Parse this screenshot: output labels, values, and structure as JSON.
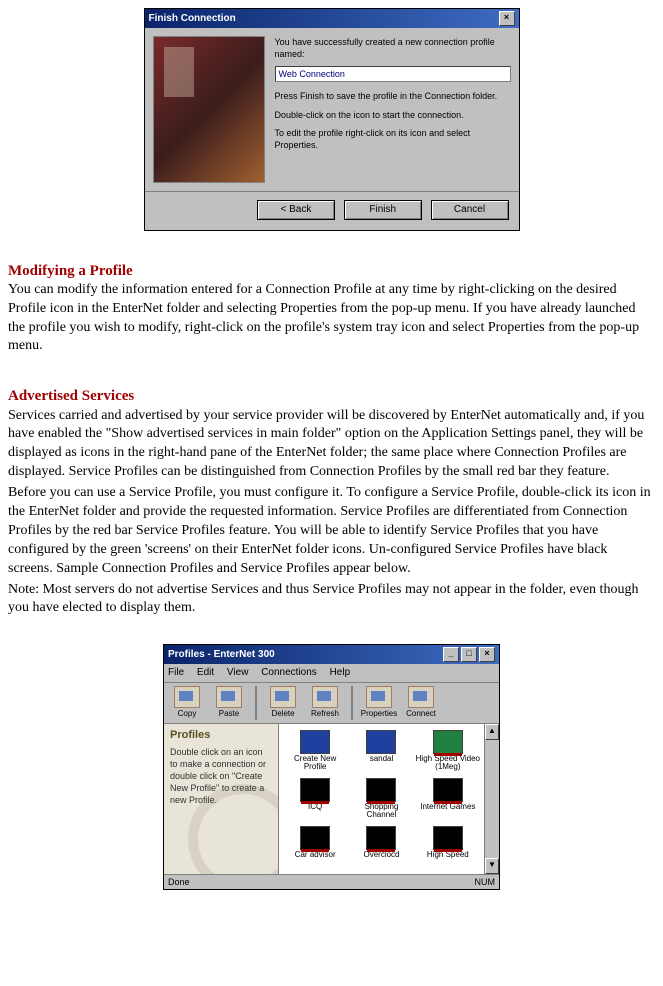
{
  "dialog1": {
    "title": "Finish Connection",
    "success_line": "You have successfully created a new connection profile named:",
    "profile_name": "Web Connection",
    "inst_finish": "Press Finish to save the profile in the Connection folder.",
    "inst_dbl": "Double-click on the icon to start the connection.",
    "inst_edit": "To edit the profile right-click on its icon and select Properties.",
    "btn_back": "< Back",
    "btn_finish": "Finish",
    "btn_cancel": "Cancel"
  },
  "section1": {
    "heading": "Modifying a Profile",
    "body": "You can modify the information entered for a Connection Profile at any time by right-clicking on the desired Profile icon in the EnterNet folder and selecting Properties from the pop-up menu. If you have already launched the profile you wish to modify, right-click on the profile's system tray icon and select Properties from the pop-up menu."
  },
  "section2": {
    "heading": "Advertised Services",
    "p1": "Services carried and advertised by your service provider will be discovered by EnterNet automatically and, if you have enabled the \"Show advertised services in main folder\" option on the Application Settings panel, they will be displayed as icons in the right-hand pane of the EnterNet folder; the same place where Connection Profiles are displayed. Service Profiles can be distinguished from Connection Profiles by the small red bar they feature.",
    "p2": "Before you can use a Service Profile, you must configure it. To configure a Service Profile, double-click its icon in the EnterNet folder and provide the requested information. Service Profiles are differentiated from Connection Profiles by the red bar Service Profiles feature. You will be able to identify Service Profiles that you have configured by the green 'screens' on their EnterNet folder icons. Un-configured Service Profiles have black screens. Sample Connection Profiles and Service Profiles appear below.",
    "p3": "Note: Most servers do not advertise Services and thus Service Profiles may not appear in the folder, even though you have elected to display them."
  },
  "profwin": {
    "title": "Profiles - EnterNet 300",
    "menu": [
      "File",
      "Edit",
      "View",
      "Connections",
      "Help"
    ],
    "toolbar": [
      "Copy",
      "Paste",
      "Delete",
      "Refresh",
      "Properties",
      "Connect"
    ],
    "sidebar_title": "Profiles",
    "sidebar_text": "Double click on an icon to make a connection or double click on \"Create New Profile\" to create a new Profile.",
    "icons": [
      {
        "label": "Create New Profile",
        "cls": "blue noredbar"
      },
      {
        "label": "sandal",
        "cls": "blue noredbar"
      },
      {
        "label": "High Speed Video (1Meg)",
        "cls": "green"
      },
      {
        "label": "ICQ",
        "cls": "black"
      },
      {
        "label": "Shopping Channel",
        "cls": "black"
      },
      {
        "label": "Internet Games",
        "cls": "black"
      },
      {
        "label": "Car advisor",
        "cls": "black"
      },
      {
        "label": "Overclocd",
        "cls": "black"
      },
      {
        "label": "High Speed",
        "cls": "black"
      }
    ],
    "status_left": "Done",
    "status_right": "NUM"
  }
}
